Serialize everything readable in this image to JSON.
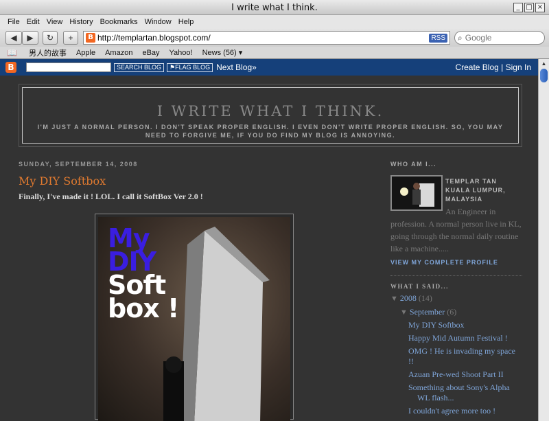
{
  "window": {
    "title": "I write what I think.",
    "buttons": [
      "_",
      "□",
      "×"
    ]
  },
  "menubar": [
    "File",
    "Edit",
    "View",
    "History",
    "Bookmarks",
    "Window",
    "Help"
  ],
  "navbar": {
    "back": "◀",
    "forward": "▶",
    "reload": "↻",
    "add": "+",
    "url": "http://templartan.blogspot.com/",
    "rss": "RSS",
    "search_placeholder": "Google"
  },
  "bookmarks": [
    "男人的故事",
    "Apple",
    "Amazon",
    "eBay",
    "Yahoo!",
    "News (56) ▾"
  ],
  "blogger_bar": {
    "search_button": "SEARCH BLOG",
    "flag_button": "⚑FLAG BLOG",
    "next_blog": "Next Blog»",
    "create_blog": "Create Blog",
    "divider": "|",
    "sign_in": "Sign In"
  },
  "header": {
    "title": "I WRITE WHAT I THINK.",
    "description": "I'M JUST A NORMAL PERSON. I DON'T SPEAK PROPER ENGLISH. I EVEN DON'T WRITE PROPER ENGLISH. SO, YOU MAY NEED TO FORGIVE ME, IF YOU DO FIND MY BLOG IS ANNOYING."
  },
  "post": {
    "date": "SUNDAY, SEPTEMBER 14, 2008",
    "title": "My DIY Softbox",
    "body": "Finally, I've made it ! LOL. I call it SoftBox Ver 2.0 !",
    "image_text_line1": "My",
    "image_text_line2": "DIY",
    "image_text_line3": "Soft",
    "image_text_line4": "box !"
  },
  "sidebar": {
    "about_title": "WHO AM I...",
    "name": "TEMPLAR TAN",
    "location1": "KUALA LUMPUR,",
    "location2": "MALAYSIA",
    "about": "An Engineer in profession. A normal person live in KL, going through the normal daily routine like a machine.....",
    "view_profile": "VIEW MY COMPLETE PROFILE",
    "archive_title": "WHAT I SAID...",
    "year": "2008",
    "year_count": "(14)",
    "month": "September",
    "month_count": "(6)",
    "posts": [
      "My DIY Softbox",
      "Happy Mid Autumn Festival !",
      "OMG ! He is invading my space !!",
      "Azuan Pre-wed Shoot Part II",
      "Something about Sony's Alpha",
      "WL flash...",
      "I couldn't agree more too !"
    ]
  }
}
